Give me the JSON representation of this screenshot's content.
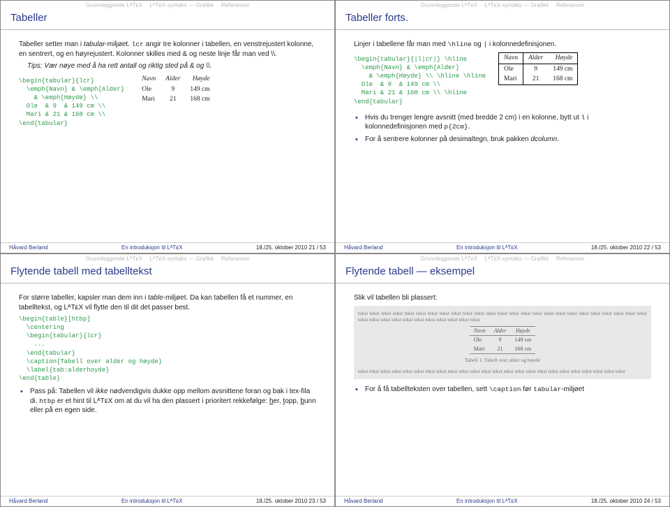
{
  "nav": {
    "item1": "Grunnleggende LᴬTᴇX",
    "item2": "LᴬTᴇX-syntaks",
    "sep": "—",
    "item3": "Grafikk",
    "item4": "Referanser"
  },
  "slide21": {
    "title": "Tabeller",
    "p1a": "Tabeller setter man i ",
    "p1b": "tabular",
    "p1c": "-miljøet. ",
    "p1d": "lcr",
    "p1e": " angir tre kolonner i tabellen, en venstrejustert kolonne, en sentrert, og en høyrejustert. Kolonner skilles med & og neste linje får man ved \\\\.",
    "tip": "Tips: Vær nøye med å ha rett antall og riktig sted på & og \\\\.",
    "code": "\\begin{tabular}{lcr}\n  \\emph{Navn} & \\emph{Alder}\n    & \\emph{Høyde} \\\\\n  Ole  & 9  & 149 cm \\\\\n  Mari & 21 & 168 cm \\\\\n\\end{tabular}",
    "table": {
      "h1": "Navn",
      "h2": "Alder",
      "h3": "Høyde",
      "r1c1": "Ole",
      "r1c2": "9",
      "r1c3": "149 cm",
      "r2c1": "Mari",
      "r2c2": "21",
      "r2c3": "168 cm"
    },
    "footer": {
      "author": "Håvard Berland",
      "mid": "En introduksjon til LᴬTᴇX",
      "right": "18./25. oktober 2010    21 / 53"
    }
  },
  "slide22": {
    "title": "Tabeller forts.",
    "p1a": "Linjer i tabellene får man med ",
    "p1b": "\\hline",
    "p1c": " og ",
    "p1d": "|",
    "p1e": " i kolonnedefinisjonen.",
    "code": "\\begin{tabular}{|l|cr|} \\hline\n  \\emph{Navn} & \\emph{Alder}\n    & \\emph{Høyde} \\\\ \\hline \\hline\n  Ole  & 9  & 149 cm \\\\\n  Mari & 21 & 168 cm \\\\ \\hline\n\\end{tabular}",
    "table": {
      "h1": "Navn",
      "h2": "Alder",
      "h3": "Høyde",
      "r1c1": "Ole",
      "r1c2": "9",
      "r1c3": "149 cm",
      "r2c1": "Mari",
      "r2c2": "21",
      "r2c3": "168 cm"
    },
    "b1a": "Hvis du trenger lengre avsnitt (med bredde 2 cm) i en kolonne, bytt ut ",
    "b1b": "l",
    "b1c": " i kolonnedefinisjonen med ",
    "b1d": "p{2cm}",
    "b1e": ".",
    "b2a": "For å sentrere kolonner på desimaltegn, bruk pakken ",
    "b2b": "dcolumn",
    "b2c": ".",
    "footer": {
      "author": "Håvard Berland",
      "mid": "En introduksjon til LᴬTᴇX",
      "right": "18./25. oktober 2010    22 / 53"
    }
  },
  "slide23": {
    "title": "Flytende tabell med tabelltekst",
    "p1a": "For større tabeller, kapsler man dem inn i ",
    "p1b": "table",
    "p1c": "-miljøet. Da kan tabellen få et nummer, en tabelltekst, og LᴬTᴇX vil flytte den til dit det passer best.",
    "code": "\\begin{table}[htbp]\n  \\centering\n  \\begin{tabular}{lcr}\n    ...\n  \\end{tabular}\n  \\caption{Tabell over alder og høyde}\n  \\label{tab:alderhoyde}\n\\end{table}",
    "b1a": "Pass på: Tabellen vil ",
    "b1b": "ikke",
    "b1c": " nødvendigvis dukke opp mellom avsnittene foran og bak i tex-fila di. ",
    "b1d": "htbp",
    "b1e": " er et hint til LᴬTᴇX om at du vil ha den plassert i prioritert rekkefølge: ",
    "b1f": "h",
    "b1g": "er, ",
    "b1h": "t",
    "b1i": "opp, ",
    "b1j": "b",
    "b1k": "unn eller på en egen side.",
    "footer": {
      "author": "Håvard Berland",
      "mid": "En introduksjon til LᴬTᴇX",
      "right": "18./25. oktober 2010    23 / 53"
    }
  },
  "slide24": {
    "title": "Flytende tabell — eksempel",
    "intro": "Slik vil tabellen bli plassert:",
    "lorem": "tekst tekst tekst tekst tekst tekst tekst tekst tekst tekst tekst tekst tekst tekst tekst tekst tekst tekst tekst tekst tekst tekst tekst tekst tekst tekst tekst tekst tekst tekst tekst tekst tekst tekst tekst tekst",
    "lorem2": "tekst tekst tekst tekst tekst tekst tekst tekst tekst tekst tekst tekst tekst tekst tekst tekst tekst tekst tekst tekst tekst tekst tekst tekst",
    "innerTable": {
      "h1": "Navn",
      "h2": "Alder",
      "h3": "Høyde",
      "r1c1": "Ole",
      "r1c2": "9",
      "r1c3": "149 cm",
      "r2c1": "Mari",
      "r2c2": "21",
      "r2c3": "168 cm",
      "caption": "Tabell 1: Tabell over alder og høyde"
    },
    "b1a": "For å få tabellteksten over tabellen, sett ",
    "b1b": "\\caption",
    "b1c": " før ",
    "b1d": "tabular",
    "b1e": "-miljøet",
    "footer": {
      "author": "Håvard Berland",
      "mid": "En introduksjon til LᴬTᴇX",
      "right": "18./25. oktober 2010    24 / 53"
    }
  }
}
